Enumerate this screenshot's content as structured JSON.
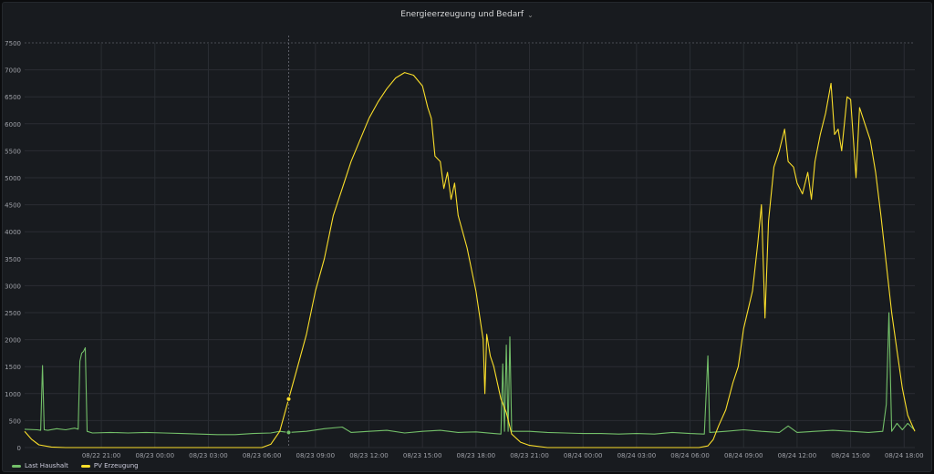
{
  "panel": {
    "title": "Energieerzeugung und Bedarf",
    "chevron": "chevron-down-icon"
  },
  "colors": {
    "bg": "#181b1f",
    "grid": "#2a2d33",
    "axis_text": "#9fa1a8",
    "last": "#73bf69",
    "pv": "#fade2a"
  },
  "chart_data": {
    "type": "line",
    "ylim": [
      0,
      7500
    ],
    "yticks": [
      0,
      500,
      1000,
      1500,
      2000,
      2500,
      3000,
      3500,
      4000,
      4500,
      5000,
      5500,
      6000,
      6500,
      7000,
      7500
    ],
    "x_range_hours": [
      -4.3,
      45.6
    ],
    "x_ticks": [
      {
        "h": 0,
        "label": "08/22 21:00"
      },
      {
        "h": 3,
        "label": "08/23 00:00"
      },
      {
        "h": 6,
        "label": "08/23 03:00"
      },
      {
        "h": 9,
        "label": "08/23 06:00"
      },
      {
        "h": 12,
        "label": "08/23 09:00"
      },
      {
        "h": 15,
        "label": "08/23 12:00"
      },
      {
        "h": 18,
        "label": "08/23 15:00"
      },
      {
        "h": 21,
        "label": "08/23 18:00"
      },
      {
        "h": 24,
        "label": "08/23 21:00"
      },
      {
        "h": 27,
        "label": "08/24 00:00"
      },
      {
        "h": 30,
        "label": "08/24 03:00"
      },
      {
        "h": 33,
        "label": "08/24 06:00"
      },
      {
        "h": 36,
        "label": "08/24 09:00"
      },
      {
        "h": 39,
        "label": "08/24 12:00"
      },
      {
        "h": 42,
        "label": "08/24 15:00"
      },
      {
        "h": 45,
        "label": "08/24 18:00"
      }
    ],
    "hover_time_h": 10.5,
    "series": [
      {
        "name": "Last Haushalt",
        "points": [
          [
            -4.3,
            340
          ],
          [
            -3.6,
            330
          ],
          [
            -3.4,
            320
          ],
          [
            -3.3,
            1520
          ],
          [
            -3.2,
            330
          ],
          [
            -3.0,
            320
          ],
          [
            -2.5,
            350
          ],
          [
            -2.0,
            330
          ],
          [
            -1.5,
            360
          ],
          [
            -1.3,
            340
          ],
          [
            -1.2,
            1600
          ],
          [
            -1.1,
            1750
          ],
          [
            -1.0,
            1780
          ],
          [
            -0.9,
            1850
          ],
          [
            -0.8,
            300
          ],
          [
            -0.5,
            270
          ],
          [
            0.5,
            280
          ],
          [
            1.5,
            270
          ],
          [
            2.5,
            280
          ],
          [
            3.5,
            270
          ],
          [
            4.5,
            260
          ],
          [
            5.5,
            250
          ],
          [
            6.5,
            240
          ],
          [
            7.5,
            240
          ],
          [
            8.5,
            260
          ],
          [
            9.5,
            270
          ],
          [
            10.0,
            300
          ],
          [
            10.5,
            280
          ],
          [
            11.5,
            300
          ],
          [
            12.5,
            350
          ],
          [
            13.5,
            380
          ],
          [
            14.0,
            280
          ],
          [
            15.0,
            300
          ],
          [
            16.0,
            320
          ],
          [
            17.0,
            270
          ],
          [
            18.0,
            300
          ],
          [
            19.0,
            320
          ],
          [
            20.0,
            280
          ],
          [
            21.0,
            290
          ],
          [
            22.0,
            260
          ],
          [
            22.4,
            250
          ],
          [
            22.5,
            1550
          ],
          [
            22.6,
            300
          ],
          [
            22.7,
            1900
          ],
          [
            22.8,
            300
          ],
          [
            22.9,
            2050
          ],
          [
            23.0,
            300
          ],
          [
            24.0,
            300
          ],
          [
            25.0,
            280
          ],
          [
            26.0,
            270
          ],
          [
            27.0,
            260
          ],
          [
            28.0,
            260
          ],
          [
            29.0,
            250
          ],
          [
            30.0,
            260
          ],
          [
            31.0,
            250
          ],
          [
            32.0,
            280
          ],
          [
            33.0,
            260
          ],
          [
            33.8,
            250
          ],
          [
            34.0,
            1700
          ],
          [
            34.1,
            280
          ],
          [
            35.0,
            300
          ],
          [
            36.0,
            330
          ],
          [
            37.0,
            300
          ],
          [
            38.0,
            280
          ],
          [
            38.5,
            400
          ],
          [
            39.0,
            280
          ],
          [
            40.0,
            300
          ],
          [
            41.0,
            320
          ],
          [
            42.0,
            300
          ],
          [
            43.0,
            280
          ],
          [
            43.8,
            300
          ],
          [
            44.0,
            800
          ],
          [
            44.15,
            2500
          ],
          [
            44.3,
            300
          ],
          [
            44.6,
            450
          ],
          [
            44.9,
            330
          ],
          [
            45.2,
            450
          ],
          [
            45.6,
            320
          ]
        ]
      },
      {
        "name": "PV Erzeugung",
        "points": [
          [
            -4.3,
            300
          ],
          [
            -3.9,
            150
          ],
          [
            -3.5,
            50
          ],
          [
            -2.8,
            10
          ],
          [
            -2.0,
            0
          ],
          [
            9.0,
            0
          ],
          [
            9.5,
            60
          ],
          [
            10.0,
            300
          ],
          [
            10.5,
            900
          ],
          [
            11.0,
            1500
          ],
          [
            11.5,
            2100
          ],
          [
            12.0,
            2900
          ],
          [
            12.5,
            3500
          ],
          [
            13.0,
            4300
          ],
          [
            13.5,
            4800
          ],
          [
            14.0,
            5300
          ],
          [
            14.5,
            5700
          ],
          [
            15.0,
            6100
          ],
          [
            15.5,
            6400
          ],
          [
            16.0,
            6650
          ],
          [
            16.5,
            6850
          ],
          [
            17.0,
            6950
          ],
          [
            17.5,
            6900
          ],
          [
            18.0,
            6700
          ],
          [
            18.3,
            6300
          ],
          [
            18.5,
            6100
          ],
          [
            18.7,
            5400
          ],
          [
            19.0,
            5300
          ],
          [
            19.2,
            4800
          ],
          [
            19.4,
            5100
          ],
          [
            19.6,
            4600
          ],
          [
            19.8,
            4900
          ],
          [
            20.0,
            4300
          ],
          [
            20.5,
            3700
          ],
          [
            21.0,
            2900
          ],
          [
            21.4,
            2000
          ],
          [
            21.5,
            1000
          ],
          [
            21.6,
            2100
          ],
          [
            21.8,
            1700
          ],
          [
            22.0,
            1500
          ],
          [
            22.4,
            900
          ],
          [
            22.7,
            650
          ],
          [
            23.0,
            250
          ],
          [
            23.5,
            100
          ],
          [
            24.0,
            40
          ],
          [
            25.0,
            0
          ],
          [
            33.5,
            0
          ],
          [
            34.0,
            30
          ],
          [
            34.3,
            150
          ],
          [
            34.6,
            400
          ],
          [
            35.0,
            700
          ],
          [
            35.4,
            1200
          ],
          [
            35.7,
            1500
          ],
          [
            36.0,
            2200
          ],
          [
            36.5,
            2900
          ],
          [
            36.8,
            3800
          ],
          [
            37.0,
            4500
          ],
          [
            37.2,
            2400
          ],
          [
            37.4,
            4200
          ],
          [
            37.7,
            5200
          ],
          [
            38.0,
            5500
          ],
          [
            38.3,
            5900
          ],
          [
            38.5,
            5300
          ],
          [
            38.8,
            5200
          ],
          [
            39.0,
            4900
          ],
          [
            39.3,
            4700
          ],
          [
            39.6,
            5100
          ],
          [
            39.8,
            4600
          ],
          [
            40.0,
            5300
          ],
          [
            40.3,
            5800
          ],
          [
            40.6,
            6200
          ],
          [
            40.9,
            6750
          ],
          [
            41.1,
            5800
          ],
          [
            41.3,
            5900
          ],
          [
            41.5,
            5500
          ],
          [
            41.8,
            6500
          ],
          [
            42.0,
            6450
          ],
          [
            42.3,
            5000
          ],
          [
            42.5,
            6300
          ],
          [
            42.8,
            6000
          ],
          [
            43.1,
            5700
          ],
          [
            43.4,
            5100
          ],
          [
            43.7,
            4300
          ],
          [
            44.0,
            3400
          ],
          [
            44.3,
            2500
          ],
          [
            44.6,
            1800
          ],
          [
            44.9,
            1100
          ],
          [
            45.2,
            600
          ],
          [
            45.4,
            450
          ],
          [
            45.6,
            300
          ]
        ]
      }
    ]
  }
}
